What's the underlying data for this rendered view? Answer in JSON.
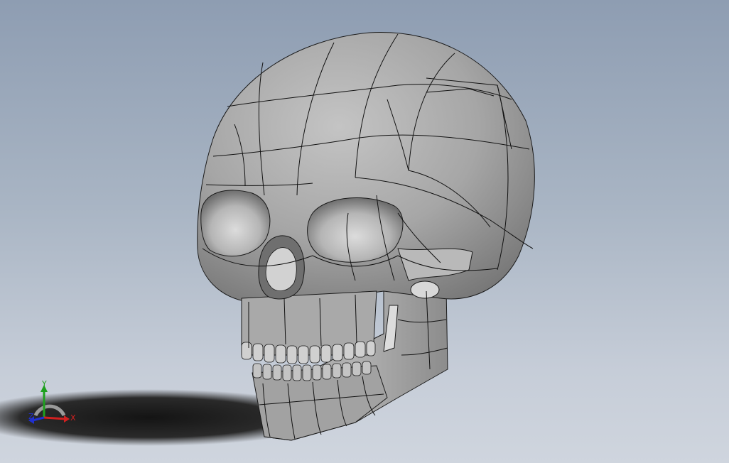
{
  "viewport": {
    "background_top": "#8e9db2",
    "background_bottom": "#cfd5de",
    "model": "skull-model",
    "shadow_color": "#1b1b1b"
  },
  "triad": {
    "x_label": "X",
    "y_label": "Y",
    "z_label": "Z",
    "x_color": "#d22020",
    "y_color": "#1ea01e",
    "z_color": "#2030d0"
  }
}
